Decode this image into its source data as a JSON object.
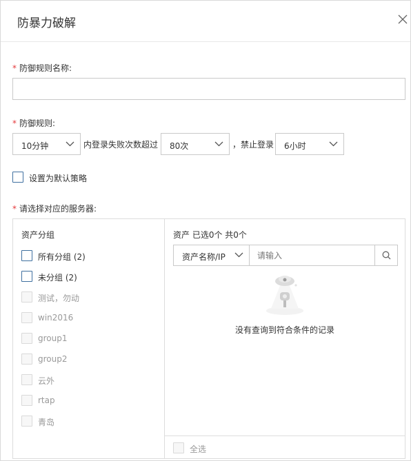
{
  "dialog": {
    "title": "防暴力破解",
    "close_icon": "close-icon"
  },
  "form": {
    "name_label": "防御规则名称:",
    "name_value": "",
    "required_mark": "*",
    "rule_label": "防御规则:",
    "period_value": "10分钟",
    "period_suffix": "内登录失败次数超过",
    "count_value": "80次",
    "count_suffix": "，禁止登录",
    "ban_value": "6小时",
    "default_label": "设置为默认策略",
    "default_checked": false,
    "server_label": "请选择对应的服务器:"
  },
  "groups": {
    "title": "资产分组",
    "items": [
      {
        "label": "所有分组 (2)",
        "enabled": true
      },
      {
        "label": "未分组 (2)",
        "enabled": true
      },
      {
        "label": "测试，勿动",
        "enabled": false
      },
      {
        "label": "win2016",
        "enabled": false
      },
      {
        "label": "group1",
        "enabled": false
      },
      {
        "label": "group2",
        "enabled": false
      },
      {
        "label": "云外",
        "enabled": false
      },
      {
        "label": "rtap",
        "enabled": false
      },
      {
        "label": "青岛",
        "enabled": false
      }
    ]
  },
  "assets": {
    "header": "资产 已选0个 共0个",
    "search_field": "资产名称/IP",
    "search_placeholder": "请输入",
    "empty_text": "没有查询到符合条件的记录",
    "select_all": "全选"
  },
  "colors": {
    "required": "#e4393c",
    "checkbox_border": "#3e6f9f",
    "border": "#c9c9c9"
  }
}
